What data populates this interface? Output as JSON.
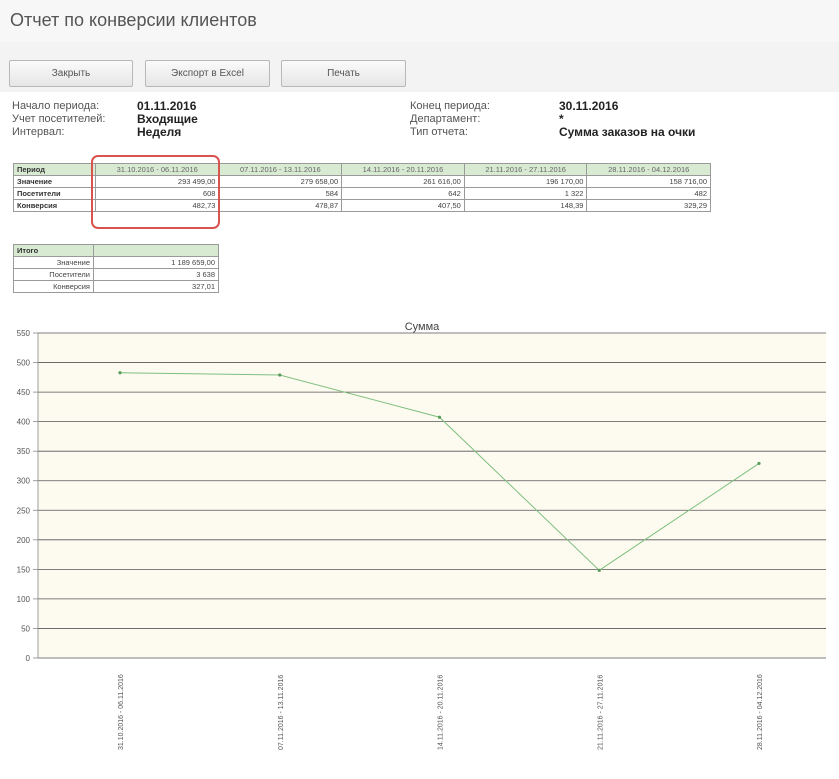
{
  "page": {
    "title": "Отчет по конверсии клиентов"
  },
  "toolbar": {
    "close_label": "Закрыть",
    "export_label": "Экспорт в Excel",
    "print_label": "Печать"
  },
  "params": {
    "start_label": "Начало периода:",
    "start_value": "01.11.2016",
    "visitors_label": "Учет посетителей:",
    "visitors_value": "Входящие",
    "interval_label": "Интервал:",
    "interval_value": "Неделя",
    "end_label": "Конец периода:",
    "end_value": "30.11.2016",
    "dept_label": "Департамент:",
    "dept_value": "*",
    "type_label": "Тип отчета:",
    "type_value": "Сумма заказов на очки"
  },
  "report_table": {
    "period_header": "Период",
    "columns": [
      "31.10.2016 - 06.11.2016",
      "07.11.2016 - 13.11.2016",
      "14.11.2016 - 20.11.2016",
      "21.11.2016 - 27.11.2016",
      "28.11.2016 - 04.12.2016"
    ],
    "rows": [
      {
        "label": "Значение",
        "values": [
          "293 499,00",
          "279 658,00",
          "261 616,00",
          "196 170,00",
          "158 716,00"
        ]
      },
      {
        "label": "Посетители",
        "values": [
          "608",
          "584",
          "642",
          "1 322",
          "482"
        ]
      },
      {
        "label": "Конверсия",
        "values": [
          "482,73",
          "478,87",
          "407,50",
          "148,39",
          "329,29"
        ]
      }
    ]
  },
  "totals_table": {
    "header": "Итого",
    "rows": [
      {
        "label": "Значение",
        "value": "1 189 659,00"
      },
      {
        "label": "Посетители",
        "value": "3 638"
      },
      {
        "label": "Конверсия",
        "value": "327,01"
      }
    ]
  },
  "chart_data": {
    "type": "line",
    "title": "Сумма",
    "xlabel": "",
    "ylabel": "",
    "categories": [
      "31.10.2016 - 06.11.2016",
      "07.11.2016 - 13.11.2016",
      "14.11.2016 - 20.11.2016",
      "21.11.2016 - 27.11.2016",
      "28.11.2016 - 04.12.2016"
    ],
    "series": [
      {
        "values": [
          482.73,
          478.87,
          407.5,
          148.39,
          329.29
        ]
      }
    ],
    "ylim": [
      0,
      550
    ],
    "yticks": [
      0,
      50,
      100,
      150,
      200,
      250,
      300,
      350,
      400,
      450,
      500,
      550
    ],
    "grid": true,
    "colors": {
      "line": "#7fbf7f",
      "background": "#fdfbf0",
      "grid": "#555555",
      "point": "#5a9a5a"
    }
  },
  "colors": {
    "header_bg": "#d9ead3",
    "highlight": "#d9534f"
  }
}
